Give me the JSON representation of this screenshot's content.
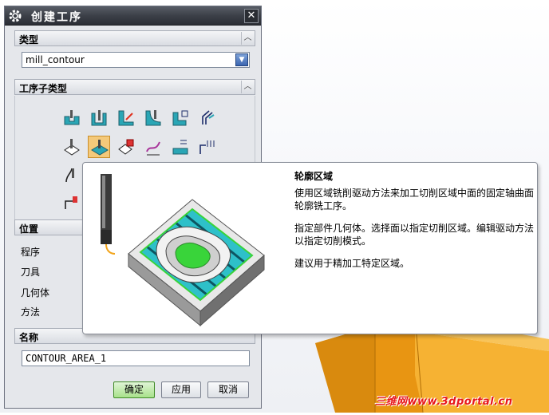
{
  "dialog": {
    "title": "创建工序",
    "close_label": "✕"
  },
  "type_section": {
    "label": "类型",
    "selected_value": "mill_contour"
  },
  "subtype_section": {
    "label": "工序子类型"
  },
  "location_section": {
    "label": "位置",
    "rows": [
      "程序",
      "刀具",
      "几何体",
      "方法"
    ]
  },
  "name_section": {
    "label": "名称",
    "value": "CONTOUR_AREA_1"
  },
  "buttons": {
    "ok": "确定",
    "apply": "应用",
    "cancel": "取消"
  },
  "tooltip": {
    "title": "轮廓区域",
    "lines": [
      "使用区域铣削驱动方法来加工切削区域中面的固定轴曲面",
      "轮廓铣工序。",
      "指定部件几何体。选择面以指定切削区域。编辑驱动方法",
      "以指定切削模式。",
      "建议用于精加工特定区域。"
    ]
  },
  "watermark": "三维网www.3dportal.cn",
  "colors": {
    "titlebar": "#3c4048",
    "dialog_bg": "#e5e7eb",
    "selected_icon": "#f4c97a",
    "ok_button": "#a7e28a",
    "viewport_part": "#f2a41a",
    "watermark": "#e8161a"
  }
}
